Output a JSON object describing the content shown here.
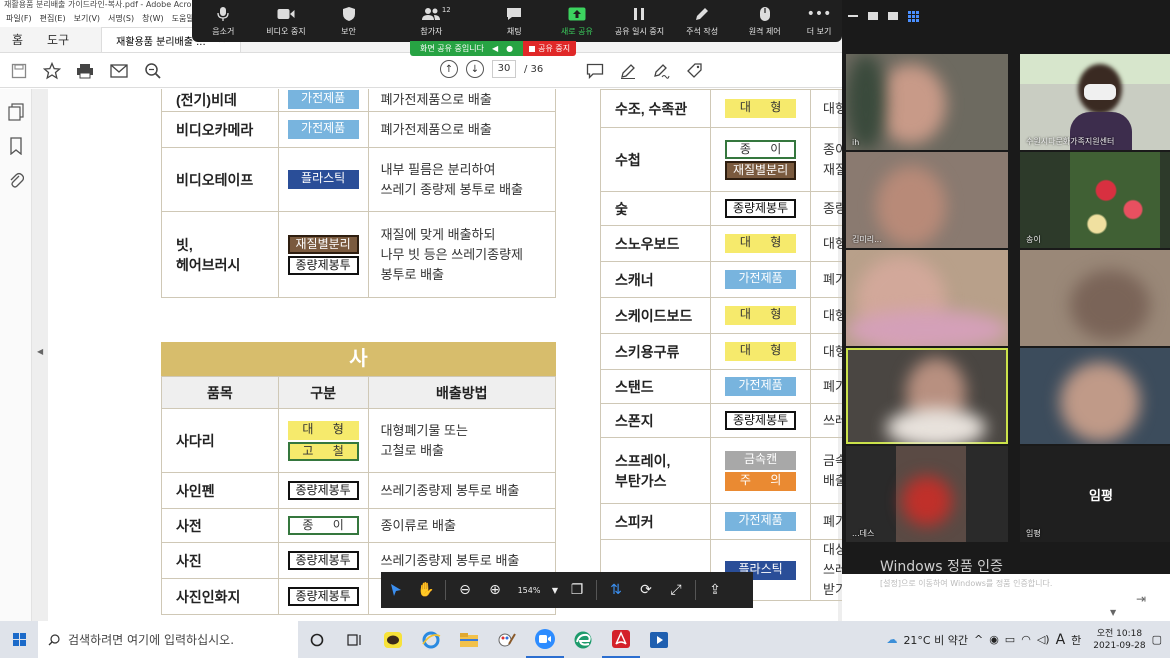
{
  "acrobat": {
    "title": "재활용품 분리배출 가이드라인-복사.pdf - Adobe Acrobat Reader DC",
    "menu": [
      "파일(F)",
      "편집(E)",
      "보기(V)",
      "서명(S)",
      "창(W)",
      "도움말(H)"
    ],
    "tabs": {
      "home": "홈",
      "tools": "도구",
      "document": "재활용품 분리배출 ..."
    },
    "page_current": "30",
    "page_total": "/ 36"
  },
  "zoom": {
    "toolbar": [
      {
        "icon": "microphone-icon",
        "label": "음소거"
      },
      {
        "icon": "video-icon",
        "label": "비디오 중지"
      },
      {
        "icon": "shield-icon",
        "label": "보안"
      },
      {
        "icon": "participants-icon",
        "label": "참가자"
      },
      {
        "icon": "chat-icon",
        "label": "채팅"
      },
      {
        "icon": "share-icon",
        "label": "새로 공유"
      },
      {
        "icon": "pause-icon",
        "label": "공유 일시 중지"
      },
      {
        "icon": "annotate-icon",
        "label": "주석 작성"
      },
      {
        "icon": "remote-control-icon",
        "label": "원격 제어"
      },
      {
        "icon": "more-icon",
        "label": "더 보기"
      }
    ],
    "participant_count": "12",
    "sharing_status": "화면 공유 중입니다",
    "stop_share": "공유 중지"
  },
  "gallery": {
    "tiles": [
      {
        "name": "ih"
      },
      {
        "name": "수원시다문화가족지원센터"
      },
      {
        "name": "김미리..."
      },
      {
        "name": "송이"
      },
      {
        "name": ""
      },
      {
        "name": ""
      },
      {
        "name": ""
      },
      {
        "name": ""
      },
      {
        "name": "...데스"
      },
      {
        "name": "임평"
      }
    ],
    "big_name": "임평",
    "watermark_title": "Windows 정품 인증",
    "watermark_sub": "[설정]으로 이동하여 Windows를 정품 인증합니다."
  },
  "pdf": {
    "left_top_rows": [
      {
        "item": "(전기)비데",
        "badges": [
          {
            "t": "가전제품",
            "c": "b-appliance"
          }
        ],
        "desc": [
          "폐가전제품으로 배출"
        ]
      },
      {
        "item": "비디오카메라",
        "badges": [
          {
            "t": "가전제품",
            "c": "b-appliance"
          }
        ],
        "desc": [
          "폐가전제품으로 배출"
        ]
      },
      {
        "item": "비디오테이프",
        "badges": [
          {
            "t": "플라스틱",
            "c": "b-plastic"
          }
        ],
        "desc": [
          "내부 필름은 분리하여",
          "쓰레기 종량제 봉투로 배출"
        ]
      },
      {
        "item": [
          "빗,",
          "헤어브러시"
        ],
        "badges": [
          {
            "t": "재질별분리",
            "c": "b-sorting"
          },
          {
            "t": "종량제봉투",
            "c": "b-bag"
          }
        ],
        "desc": [
          "재질에 맞게 배출하되",
          "나무 빗 등은 쓰레기종량제",
          "봉투로 배출"
        ]
      }
    ],
    "section_sa": "사",
    "col_headers": [
      "품목",
      "구분",
      "배출방법"
    ],
    "left_bottom_rows": [
      {
        "item": "사다리",
        "badges": [
          {
            "t": "대 형",
            "c": "b-large"
          },
          {
            "t": "고 철",
            "c": "b-iron"
          }
        ],
        "desc": [
          "대형폐기물  또는",
          "고철로 배출"
        ]
      },
      {
        "item": "사인펜",
        "badges": [
          {
            "t": "종량제봉투",
            "c": "b-bag"
          }
        ],
        "desc": [
          "쓰레기종량제 봉투로 배출"
        ]
      },
      {
        "item": "사전",
        "badges": [
          {
            "t": "종 이",
            "c": "b-paper"
          }
        ],
        "desc": [
          "종이류로 배출"
        ]
      },
      {
        "item": "사진",
        "badges": [
          {
            "t": "종량제봉투",
            "c": "b-bag"
          }
        ],
        "desc": [
          "쓰레기종량제 봉투로 배출"
        ]
      },
      {
        "item": "사진인화지",
        "badges": [
          {
            "t": "종량제봉투",
            "c": "b-bag"
          }
        ],
        "desc": [
          ""
        ]
      }
    ],
    "right_rows": [
      {
        "item": "수조, 수족관",
        "badges": [
          {
            "t": "대 형",
            "c": "b-large"
          }
        ],
        "desc": [
          "대형"
        ],
        "h": 38
      },
      {
        "item": "수첩",
        "badges": [
          {
            "t": "종 이",
            "c": "b-paper"
          },
          {
            "t": "재질별분리",
            "c": "b-sorting"
          }
        ],
        "desc": [
          "종이",
          "재질"
        ],
        "h": 64
      },
      {
        "item": "숯",
        "badges": [
          {
            "t": "종량제봉투",
            "c": "b-bag"
          }
        ],
        "desc": [
          "종량"
        ],
        "h": 34
      },
      {
        "item": "스노우보드",
        "badges": [
          {
            "t": "대 형",
            "c": "b-large"
          }
        ],
        "desc": [
          "대형"
        ],
        "h": 36
      },
      {
        "item": "스캐너",
        "badges": [
          {
            "t": "가전제품",
            "c": "b-appliance"
          }
        ],
        "desc": [
          "폐가"
        ],
        "h": 36
      },
      {
        "item": "스케이드보드",
        "badges": [
          {
            "t": "대 형",
            "c": "b-large"
          }
        ],
        "desc": [
          "대형"
        ],
        "h": 36
      },
      {
        "item": "스키용구류",
        "badges": [
          {
            "t": "대 형",
            "c": "b-large"
          }
        ],
        "desc": [
          "대형"
        ],
        "h": 36
      },
      {
        "item": "스탠드",
        "badges": [
          {
            "t": "가전제품",
            "c": "b-appliance"
          }
        ],
        "desc": [
          "폐가"
        ],
        "h": 34
      },
      {
        "item": "스폰지",
        "badges": [
          {
            "t": "종량제봉투",
            "c": "b-bag"
          }
        ],
        "desc": [
          "쓰레"
        ],
        "h": 34
      },
      {
        "item": [
          "스프레이,",
          "부탄가스"
        ],
        "badges": [
          {
            "t": "금속캔",
            "c": "b-metal"
          },
          {
            "t": "주 의",
            "c": "b-caution"
          }
        ],
        "desc": [
          "금속",
          "배출"
        ],
        "h": 66
      },
      {
        "item": "스피커",
        "badges": [
          {
            "t": "가전제품",
            "c": "b-appliance"
          }
        ],
        "desc": [
          "폐가"
        ],
        "h": 36
      },
      {
        "item": "",
        "badges": [
          {
            "t": "플라스틱",
            "c": "b-plastic"
          }
        ],
        "desc": [
          "대상",
          "쓰레받기"
        ],
        "h": 60
      }
    ]
  },
  "float_toolbar": {
    "zoom": "154%"
  },
  "taskbar": {
    "search_placeholder": "검색하려면 여기에 입력하십시오.",
    "weather": "21°C 비 약간",
    "ime": "A",
    "lang": "한",
    "time_ampm": "오전 10:18",
    "date": "2021-09-28"
  }
}
